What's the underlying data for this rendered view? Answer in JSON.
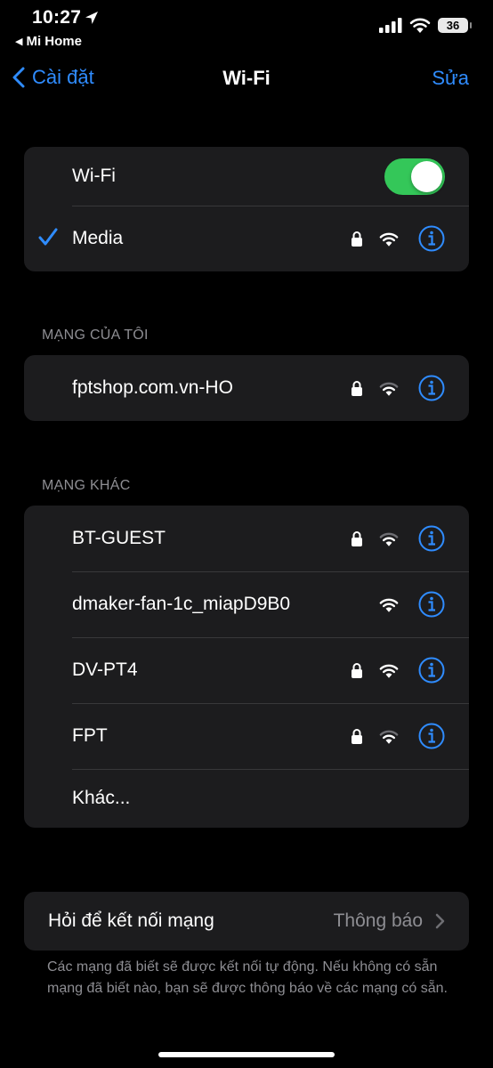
{
  "status": {
    "time": "10:27",
    "back_app": "Mi Home",
    "battery": "36"
  },
  "nav": {
    "back_label": "Cài đặt",
    "title": "Wi-Fi",
    "edit_label": "Sửa"
  },
  "wifi_toggle": {
    "label": "Wi-Fi",
    "on": true
  },
  "connected": {
    "name": "Media",
    "locked": true
  },
  "my_networks": {
    "header": "MẠNG CỦA TÔI",
    "items": [
      {
        "name": "fptshop.com.vn-HO",
        "locked": true
      }
    ]
  },
  "other_networks": {
    "header": "MẠNG KHÁC",
    "items": [
      {
        "name": "BT-GUEST",
        "locked": true
      },
      {
        "name": "dmaker-fan-1c_miapD9B0",
        "locked": false
      },
      {
        "name": "DV-PT4",
        "locked": true
      },
      {
        "name": "FPT",
        "locked": true
      }
    ],
    "other_label": "Khác..."
  },
  "ask_join": {
    "label": "Hỏi để kết nối mạng",
    "value": "Thông báo"
  },
  "footer_note": "Các mạng đã biết sẽ được kết nối tự động. Nếu không có sẵn mạng đã biết nào, bạn sẽ được thông báo về các mạng có sẵn.",
  "colors": {
    "accent": "#2f8cff",
    "toggle_on": "#34c759",
    "cell_bg": "#1c1c1e",
    "secondary_text": "#8e8e93"
  }
}
